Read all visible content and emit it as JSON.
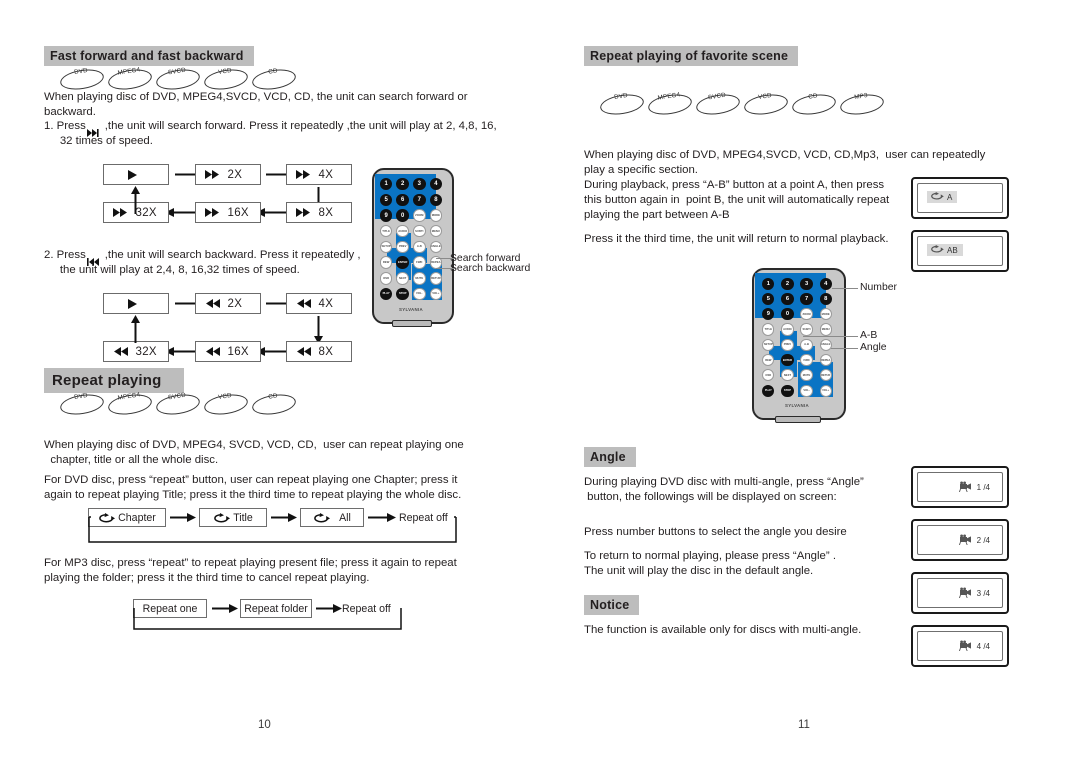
{
  "document": {
    "type": "dvd-player-user-manual-spread",
    "left_page_number": "10",
    "right_page_number": "11"
  },
  "left_page": {
    "section_fast": {
      "heading": "Fast forward and fast backward",
      "discs": [
        "DVD",
        "MPEG4",
        "SVCD",
        "VCD",
        "CD"
      ],
      "intro": "When playing disc of DVD, MPEG4,SVCD, VCD, CD, the unit can search forward or\nbackward.",
      "step1": "1. Press      ,the unit will search forward. Press it repeatedly ,the unit will play at 2, 4,8, 16,\n     32 times of speed.",
      "step2": "2. Press      ,the unit will search backward. Press it repeatedly ,\n     the unit will play at 2,4, 8, 16,32 times of speed.",
      "forward_chain_top": [
        "",
        "2X",
        "4X"
      ],
      "forward_chain_bottom": [
        "32X",
        "16X",
        "8X"
      ],
      "backward_chain_top": [
        "",
        "2X",
        "4X"
      ],
      "backward_chain_bottom": [
        "32X",
        "16X",
        "8X"
      ],
      "callouts": [
        "Search forward",
        "Search backward"
      ]
    },
    "section_repeat": {
      "heading": "Repeat playing",
      "discs": [
        "DVD",
        "MPEG4",
        "SVCD",
        "VCD",
        "CD"
      ],
      "para1": "When playing disc of DVD, MPEG4, SVCD, VCD, CD,  user can repeat playing one\n  chapter, title or all the whole disc.",
      "para2": "For DVD disc, press “repeat” button, user can repeat playing one Chapter; press it\nagain to repeat playing Title; press it the third time to repeat playing the whole disc.",
      "dvd_cycle": [
        "Chapter",
        "Title",
        "All",
        "Repeat off"
      ],
      "para3": "For MP3 disc, press “repeat” to repeat playing present file; press it again to repeat\nplaying the folder; press it the third time to cancel repeat playing.",
      "mp3_cycle": [
        "Repeat one",
        "Repeat folder",
        "Repeat off"
      ]
    }
  },
  "right_page": {
    "section_favorite": {
      "heading": "Repeat playing of favorite scene",
      "discs": [
        "DVD",
        "MPEG4",
        "SVCD",
        "VCD",
        "CD",
        "MP3"
      ],
      "para1": "When playing disc of DVD, MPEG4,SVCD, VCD, CD,Mp3,  user can repeatedly\nplay a specific section.",
      "para2": "During playback, press “A-B” button at a point A, then press\nthis button again in  point B, the unit will automatically repeat\nplaying the part between A-B",
      "para3": "Press it the third time, the unit will return to normal playback.",
      "osd_a": "A",
      "osd_ab": "AB",
      "remote_callouts": [
        "Number",
        "A-B",
        "Angle"
      ]
    },
    "section_angle": {
      "heading": "Angle",
      "para1": "During playing DVD disc with multi-angle, press “Angle”\n button, the followings will be displayed on screen:",
      "para2": "Press number buttons to select the angle you desire",
      "para3": "To return to normal playing, please press “Angle” .\nThe unit will play the disc in the default angle.",
      "osd_angles": [
        "1 /4",
        "2 /4",
        "3 /4",
        "4 /4"
      ]
    },
    "section_notice": {
      "heading": "Notice",
      "para1": "The function is available only for discs with multi-angle."
    }
  },
  "remote": {
    "brand": "SYLVANIA",
    "rows": [
      [
        "1",
        "2",
        "3",
        "4"
      ],
      [
        "5",
        "6",
        "7",
        "8"
      ],
      [
        "9",
        "0",
        "ZOOM",
        "MODE"
      ],
      [
        "TITLE",
        "AUDIO",
        "SUBTITLE",
        "MENU"
      ],
      [
        "SETUP",
        "PREV",
        "A-B",
        "ANGLE"
      ],
      [
        "REW",
        "ENTER",
        "FWD",
        "REPEAT"
      ],
      [
        "OSD",
        "NEXT",
        "MUTE",
        "RETURN"
      ],
      [
        "PLAY",
        "STOP",
        "VOL-",
        "VOL+"
      ]
    ]
  },
  "colors": {
    "header_bar": "#bdbdbd",
    "remote_body": "#c8c8c8",
    "remote_blue": "#0a74c4",
    "osd_chip": "#d9d9d9",
    "text": "#231f20"
  }
}
